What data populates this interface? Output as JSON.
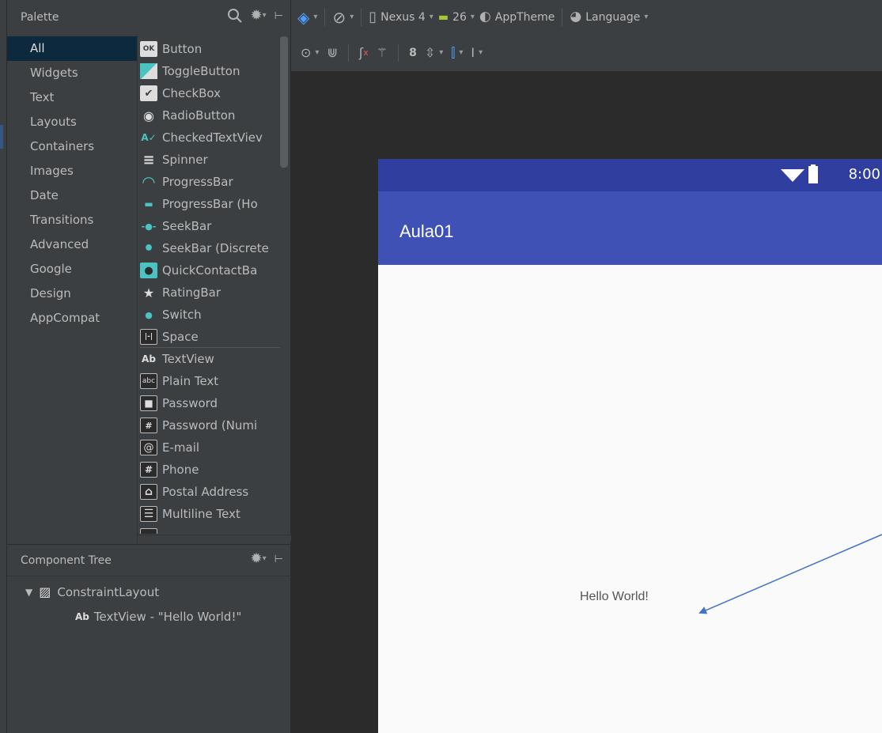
{
  "palette": {
    "title": "Palette",
    "categories": [
      "All",
      "Widgets",
      "Text",
      "Layouts",
      "Containers",
      "Images",
      "Date",
      "Transitions",
      "Advanced",
      "Google",
      "Design",
      "AppCompat"
    ],
    "selected_category": "All",
    "widgets": [
      {
        "label": "Button",
        "icon": "OK"
      },
      {
        "label": "ToggleButton",
        "icon": ""
      },
      {
        "label": "CheckBox",
        "icon": "✔"
      },
      {
        "label": "RadioButton",
        "icon": "◉"
      },
      {
        "label": "CheckedTextViev",
        "icon": "A✓"
      },
      {
        "label": "Spinner",
        "icon": "≡"
      },
      {
        "label": "ProgressBar",
        "icon": "◠"
      },
      {
        "label": "ProgressBar (Ho",
        "icon": "▬"
      },
      {
        "label": "SeekBar",
        "icon": "-●-"
      },
      {
        "label": "SeekBar (Discrete",
        "icon": "•"
      },
      {
        "label": "QuickContactBa",
        "icon": "👤"
      },
      {
        "label": "RatingBar",
        "icon": "★"
      },
      {
        "label": "Switch",
        "icon": "●"
      },
      {
        "label": "Space",
        "icon": "|-|"
      },
      {
        "label": "TextView",
        "icon": "Ab"
      },
      {
        "label": "Plain Text",
        "icon": "abc"
      },
      {
        "label": "Password",
        "icon": "🔒"
      },
      {
        "label": "Password (Numi",
        "icon": "#"
      },
      {
        "label": "E-mail",
        "icon": "@"
      },
      {
        "label": "Phone",
        "icon": "#"
      },
      {
        "label": "Postal Address",
        "icon": "⌂"
      },
      {
        "label": "Multiline Text",
        "icon": "☰"
      }
    ]
  },
  "component_tree": {
    "title": "Component Tree",
    "root": "ConstraintLayout",
    "child": "TextView - \"Hello World!\"",
    "child_prefix": "Ab"
  },
  "toolbar": {
    "device": "Nexus 4",
    "api": "26",
    "theme": "AppTheme",
    "language": "Language",
    "margin_value": "8"
  },
  "device_preview": {
    "clock": "8:00",
    "app_title": "Aula01",
    "content_text": "Hello World!",
    "statusbar_color": "#303f9f",
    "appbar_color": "#3f51b5"
  },
  "annotation": {
    "arrow_color": "#4472c4"
  }
}
